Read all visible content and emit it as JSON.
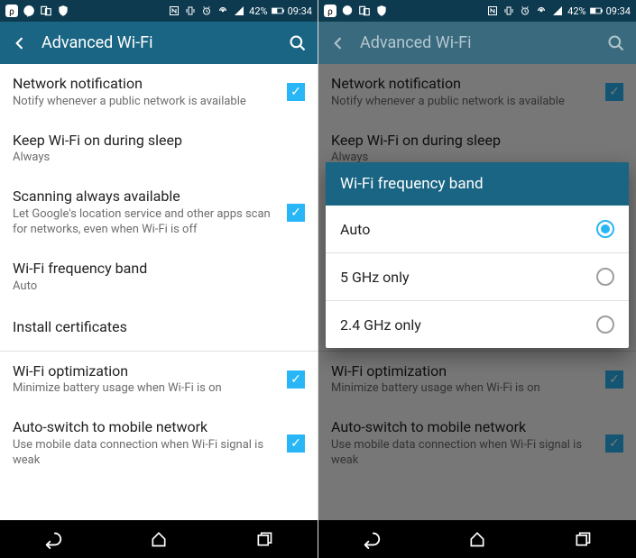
{
  "status": {
    "battery": "42%",
    "time": "09:34"
  },
  "header": {
    "title": "Advanced Wi-Fi"
  },
  "settings": {
    "network_notification": {
      "title": "Network notification",
      "sub": "Notify whenever a public network is available",
      "checked": true
    },
    "keep_wifi": {
      "title": "Keep Wi-Fi on during sleep",
      "sub": "Always"
    },
    "scanning": {
      "title": "Scanning always available",
      "sub": "Let Google's location service and other apps scan for networks, even when Wi-Fi is off",
      "checked": true
    },
    "freq": {
      "title": "Wi-Fi frequency band",
      "sub": "Auto"
    },
    "install_certs": {
      "title": "Install certificates"
    },
    "optimization": {
      "title": "Wi-Fi optimization",
      "sub": "Minimize battery usage when Wi-Fi is on",
      "checked": true
    },
    "autoswitch": {
      "title": "Auto-switch to mobile network",
      "sub": "Use mobile data connection when Wi-Fi signal is weak",
      "checked": true
    }
  },
  "dialog": {
    "title": "Wi-Fi frequency band",
    "options": [
      "Auto",
      "5 GHz only",
      "2.4 GHz only"
    ],
    "selected": 0
  }
}
